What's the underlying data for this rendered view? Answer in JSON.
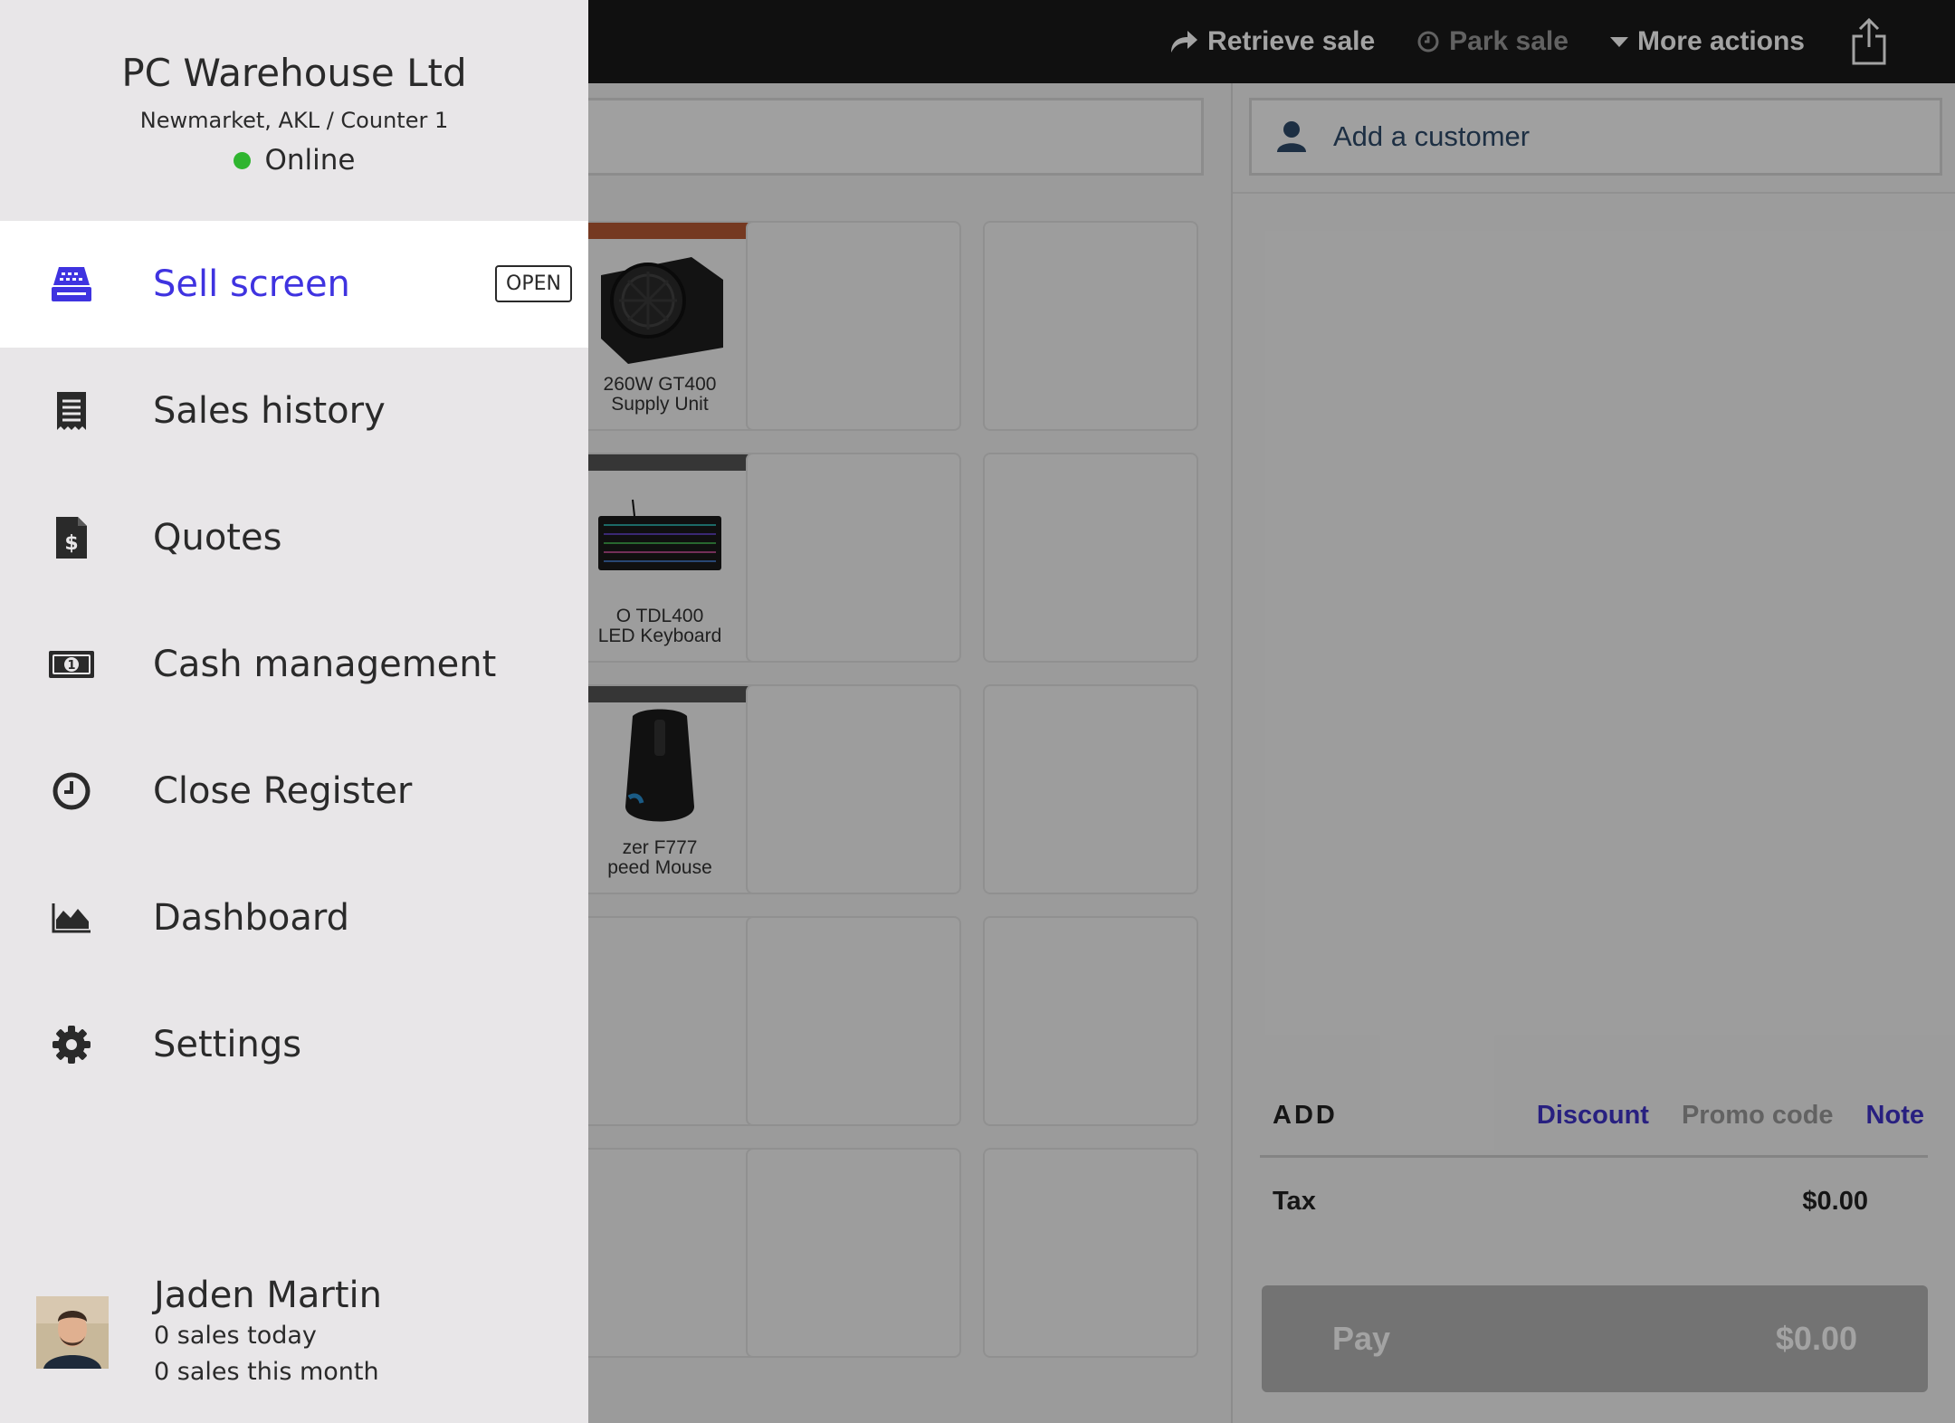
{
  "topbar": {
    "retrieve_sale": "Retrieve sale",
    "park_sale": "Park sale",
    "more_actions": "More actions"
  },
  "products": [
    {
      "line1": "260W GT400",
      "line2": "Supply Unit",
      "color": "#b85a35"
    },
    {
      "line1": "O TDL400",
      "line2": "LED Keyboard",
      "color": "#555555"
    },
    {
      "line1": "zer F777",
      "line2": "peed Mouse",
      "color": "#555555"
    }
  ],
  "sale_panel": {
    "add_customer": "Add a customer",
    "add_title": "ADD",
    "discount": "Discount",
    "promo_code": "Promo code",
    "note": "Note",
    "tax_label": "Tax",
    "tax_value": "$0.00",
    "pay_label": "Pay",
    "pay_value": "$0.00"
  },
  "drawer": {
    "store_name": "PC Warehouse Ltd",
    "location": "Newmarket, AKL / Counter 1",
    "status": "Online",
    "status_color": "#2fb52f",
    "accent_color": "#3f33e0",
    "menu": [
      {
        "label": "Sell screen",
        "icon": "cash-register-icon",
        "badge": "OPEN",
        "active": true
      },
      {
        "label": "Sales history",
        "icon": "receipt-icon"
      },
      {
        "label": "Quotes",
        "icon": "quote-document-icon"
      },
      {
        "label": "Cash management",
        "icon": "banknote-icon"
      },
      {
        "label": "Close Register",
        "icon": "clock-icon"
      },
      {
        "label": "Dashboard",
        "icon": "area-chart-icon"
      },
      {
        "label": "Settings",
        "icon": "gear-icon"
      }
    ],
    "user": {
      "name": "Jaden Martin",
      "sales_today": "0 sales today",
      "sales_month": "0 sales this month"
    }
  }
}
